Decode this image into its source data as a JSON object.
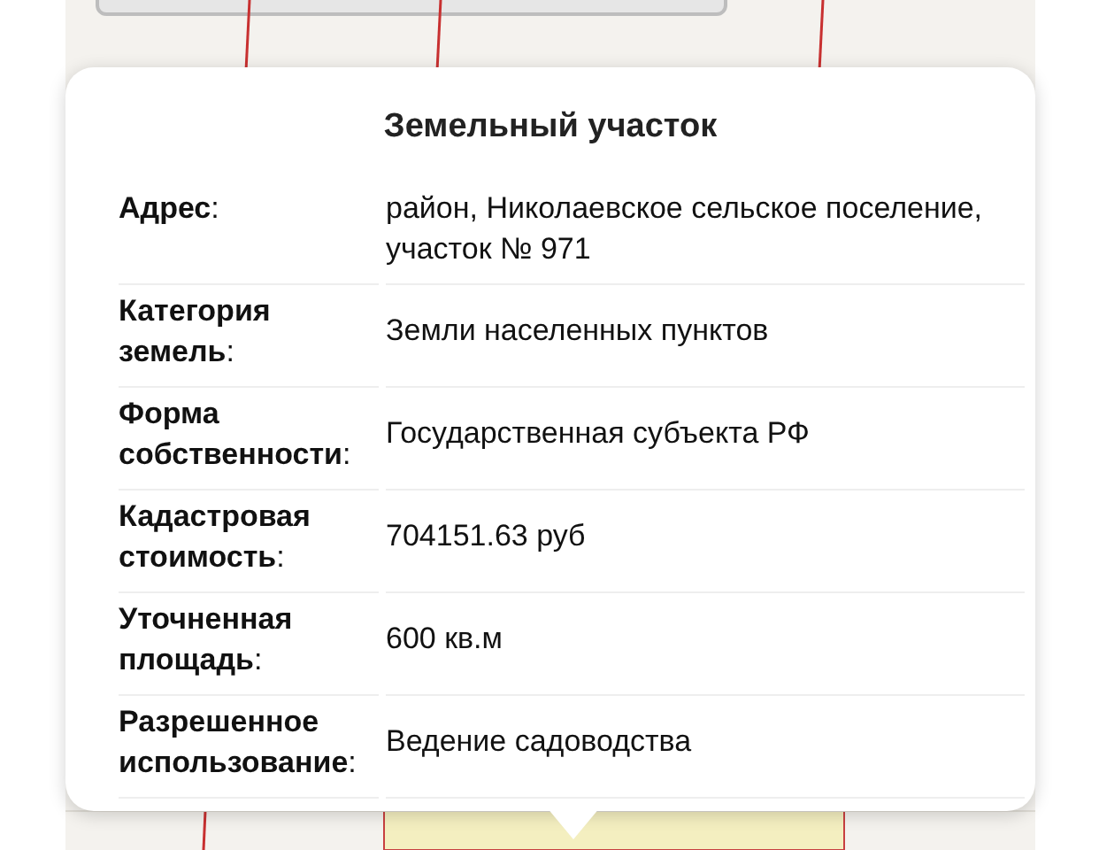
{
  "popup": {
    "title": "Земельный участок",
    "rows": [
      {
        "label": "**Адрес**:",
        "value": "район, Николаевское сельское поселение, участок № 971"
      },
      {
        "label": "**Категория земель**:",
        "value": "Земли населенных пунктов"
      },
      {
        "label": "**Форма собственности**:",
        "value": "Государственная субъекта РФ"
      },
      {
        "label": "**Кадастровая стоимость**:",
        "value": "704151.63 руб"
      },
      {
        "label": "**Уточненная площадь**:",
        "value": "600 кв.м"
      },
      {
        "label": "**Разрешенное использование**:",
        "value": "Ведение садоводства"
      }
    ]
  }
}
